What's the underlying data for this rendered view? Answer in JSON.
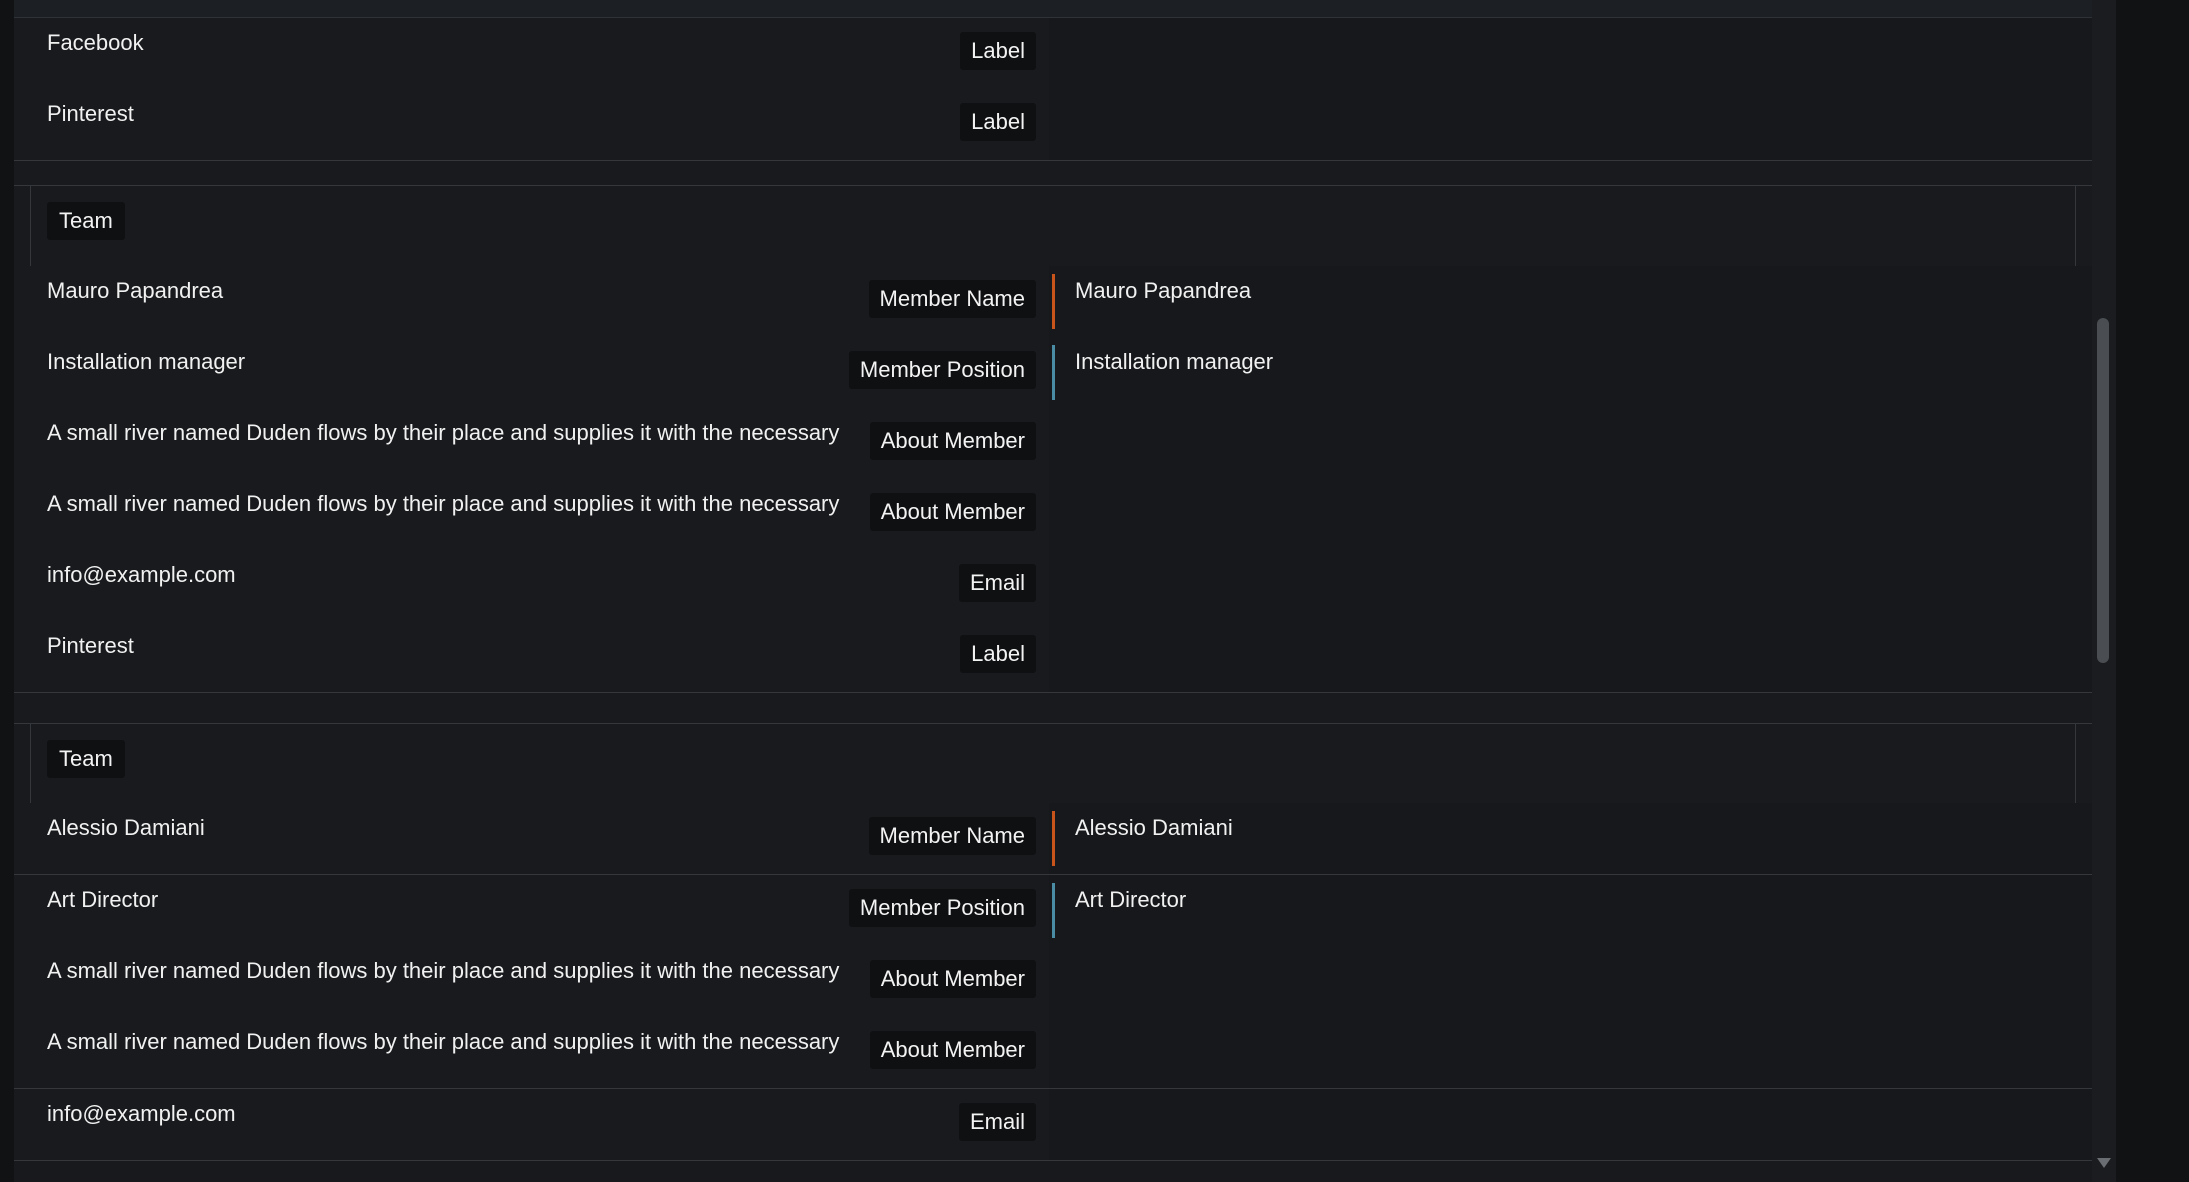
{
  "colors": {
    "name_accent": "#c8531b",
    "position_accent": "#4a8ca3"
  },
  "social_rows": [
    {
      "text": "Facebook",
      "badge": "Label"
    },
    {
      "text": "Pinterest",
      "badge": "Label"
    }
  ],
  "teams": [
    {
      "header": "Team",
      "name_row": {
        "text": "Mauro Papandrea",
        "badge": "Member Name",
        "value": "Mauro Papandrea"
      },
      "position_row": {
        "text": "Installation manager",
        "badge": "Member Position",
        "value": "Installation manager"
      },
      "rows": [
        {
          "text": "A small river named Duden flows by their place and supplies it with the necessary",
          "badge": "About Member"
        },
        {
          "text": "A small river named Duden flows by their place and supplies it with the necessary",
          "badge": "About Member"
        },
        {
          "text": "info@example.com",
          "badge": "Email"
        },
        {
          "text": "Pinterest",
          "badge": "Label"
        }
      ]
    },
    {
      "header": "Team",
      "name_row": {
        "text": "Alessio Damiani",
        "badge": "Member Name",
        "value": "Alessio Damiani"
      },
      "position_row": {
        "text": "Art Director",
        "badge": "Member Position",
        "value": "Art Director"
      },
      "rows": [
        {
          "text": "A small river named Duden flows by their place and supplies it with the necessary",
          "badge": "About Member"
        },
        {
          "text": "A small river named Duden flows by their place and supplies it with the necessary",
          "badge": "About Member"
        },
        {
          "text": "info@example.com",
          "badge": "Email"
        }
      ]
    }
  ]
}
